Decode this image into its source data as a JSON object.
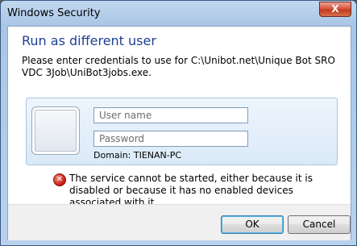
{
  "window": {
    "title": "Windows Security",
    "close_label": "X"
  },
  "dialog": {
    "heading": "Run as different user",
    "description": "Please enter credentials to use for C:\\Unibot.net\\Unique Bot SRO VDC 3Job\\UniBot3jobs.exe."
  },
  "credentials": {
    "username_placeholder": "User name",
    "password_placeholder": "Password",
    "domain": "Domain: TIENAN-PC"
  },
  "error": {
    "icon": "error-x-icon",
    "message": "The service cannot be started, either because it is disabled or because it has no enabled devices associated with it."
  },
  "buttons": {
    "ok": "OK",
    "cancel": "Cancel"
  }
}
